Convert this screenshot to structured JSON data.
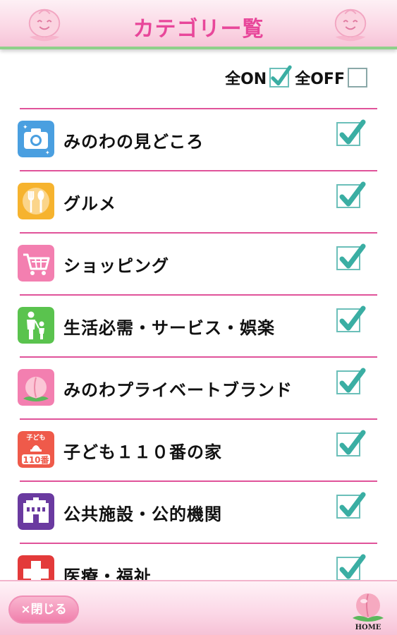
{
  "header": {
    "title": "カテゴリー覧",
    "mascot_icon": "peach-mascot-icon"
  },
  "toggles": {
    "all_on_label": "全ON",
    "all_on_checked": true,
    "all_off_label": "全OFF",
    "all_off_checked": false
  },
  "categories": [
    {
      "label": "みのわの見どころ",
      "icon": "camera-icon",
      "color": "#4a9fe0",
      "checked": true
    },
    {
      "label": "グルメ",
      "icon": "fork-spoon-icon",
      "color": "#f6b32e",
      "checked": true
    },
    {
      "label": "ショッピング",
      "icon": "shopping-cart-icon",
      "color": "#f37fb0",
      "checked": true
    },
    {
      "label": "生活必需・サービス・娯楽",
      "icon": "family-icon",
      "color": "#5ac34e",
      "checked": true
    },
    {
      "label": "みのわプライベートブランド",
      "icon": "peach-icon",
      "color": "#f37fb0",
      "checked": true
    },
    {
      "label": "子ども１１０番の家",
      "icon": "child-110-icon",
      "icon_text_top": "子ども",
      "icon_text_bottom": "110番",
      "color": "#ef5a4a",
      "checked": true
    },
    {
      "label": "公共施設・公的機関",
      "icon": "public-building-icon",
      "color": "#6a3aa0",
      "checked": true
    },
    {
      "label": "医療・福祉",
      "icon": "medical-cross-icon",
      "color": "#e33a3a",
      "checked": true
    }
  ],
  "footer": {
    "close_label": "×閉じる",
    "home_label": "HOME"
  },
  "colors": {
    "accent_pink": "#e8479a",
    "divider": "#e0539a",
    "check_teal": "#3aaea3",
    "header_green_line": "#8fd08a"
  }
}
